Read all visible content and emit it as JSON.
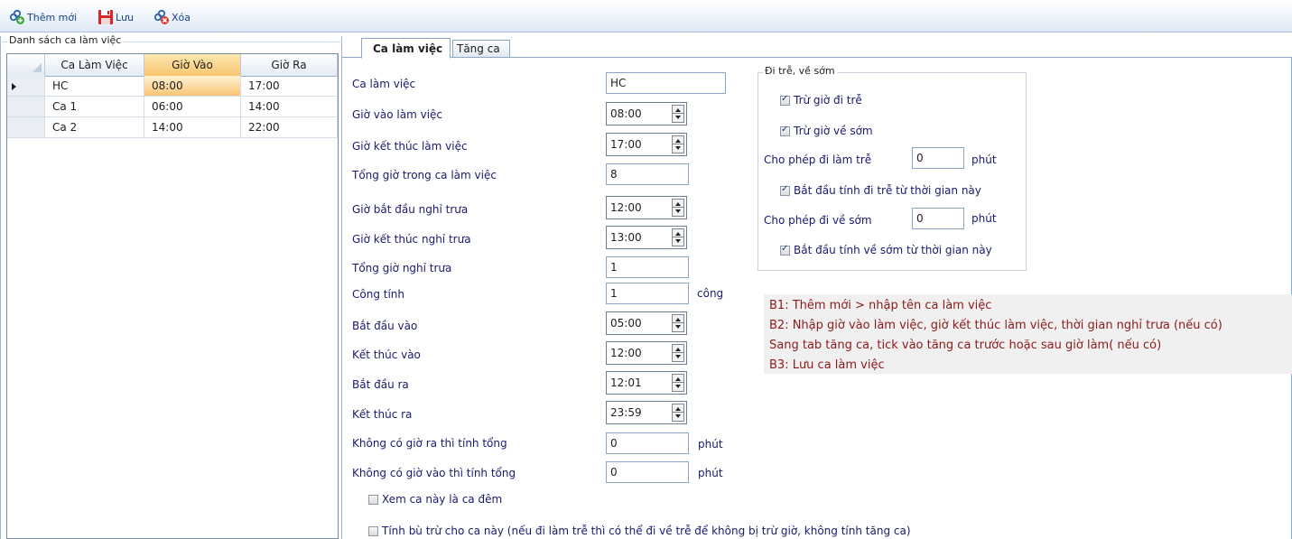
{
  "toolbar": {
    "add_label": "Thêm mới",
    "save_label": "Lưu",
    "delete_label": "Xóa"
  },
  "left_panel": {
    "group_title": "Danh sách ca làm việc",
    "columns": [
      "Ca Làm Việc",
      "Giờ Vào",
      "Giờ Ra"
    ],
    "rows": [
      {
        "name": "HC",
        "in": "08:00",
        "out": "17:00"
      },
      {
        "name": "Ca 1",
        "in": "06:00",
        "out": "14:00"
      },
      {
        "name": "Ca 2",
        "in": "14:00",
        "out": "22:00"
      }
    ]
  },
  "tabs": [
    {
      "label": "Ca làm việc"
    },
    {
      "label": "Tăng ca"
    }
  ],
  "form": {
    "ca_lam_viec": {
      "label": "Ca làm việc",
      "value": "HC"
    },
    "gio_vao": {
      "label": "Giờ vào làm việc",
      "value": "08:00"
    },
    "gio_ket_thuc": {
      "label": "Giờ kết thúc làm việc",
      "value": "17:00"
    },
    "tong_gio": {
      "label": "Tổng giờ trong ca làm việc",
      "value": "8"
    },
    "bat_dau_nghi": {
      "label": "Giờ bắt đầu nghỉ trưa",
      "value": "12:00"
    },
    "ket_thuc_nghi": {
      "label": "Giờ kết thúc nghỉ trưa",
      "value": "13:00"
    },
    "tong_nghi": {
      "label": "Tổng giờ nghỉ trưa",
      "value": "1"
    },
    "cong_tinh": {
      "label": "Công tính",
      "value": "1",
      "unit": "công"
    },
    "bat_dau_vao": {
      "label": "Bắt đầu vào",
      "value": "05:00"
    },
    "ket_thuc_vao": {
      "label": "Kết thúc vào",
      "value": "12:00"
    },
    "bat_dau_ra": {
      "label": "Bắt đầu ra",
      "value": "12:01"
    },
    "ket_thuc_ra": {
      "label": "Kết thúc ra",
      "value": "23:59"
    },
    "khong_gio_ra": {
      "label": "Không có giờ ra thì tính tổng",
      "value": "0",
      "unit": "phút"
    },
    "khong_gio_vao": {
      "label": "Không có giờ vào thì tính tổng",
      "value": "0",
      "unit": "phút"
    },
    "ca_dem": {
      "label": "Xem ca này là ca đêm",
      "checked": false
    },
    "tinh_bu_tru": {
      "label": "Tính bù trừ cho ca này (nếu đi làm trễ thì có thể đi về trễ để không bị trừ giờ, không tính tăng ca)",
      "checked": false
    }
  },
  "late_early": {
    "legend": "Đi trễ, về sớm",
    "tru_di_tre": {
      "label": "Trừ giờ đi trễ",
      "checked": true
    },
    "tru_ve_som": {
      "label": "Trừ giờ về sớm",
      "checked": true
    },
    "cho_phep_tre": {
      "label": "Cho phép đi làm trễ",
      "value": "0",
      "unit": "phút"
    },
    "bat_dau_tre": {
      "label": "Bắt đầu tính đi trễ từ thời gian này",
      "checked": true
    },
    "cho_phep_som": {
      "label": "Cho phép đi về sớm",
      "value": "0",
      "unit": "phút"
    },
    "bat_dau_som": {
      "label": "Bắt đầu tính về sớm từ thời gian này",
      "checked": true
    }
  },
  "note": {
    "lines": [
      "B1: Thêm mới > nhập tên ca làm việc",
      "B2: Nhập giờ vào làm việc, giờ kết thúc làm việc, thời gian nghỉ trưa (nếu có)",
      "Sang tab tăng ca, tick vào tăng ca trước hoặc sau giờ làm( nếu có)",
      "B3: Lưu ca làm việc"
    ],
    "color": "#8b1a1a"
  }
}
